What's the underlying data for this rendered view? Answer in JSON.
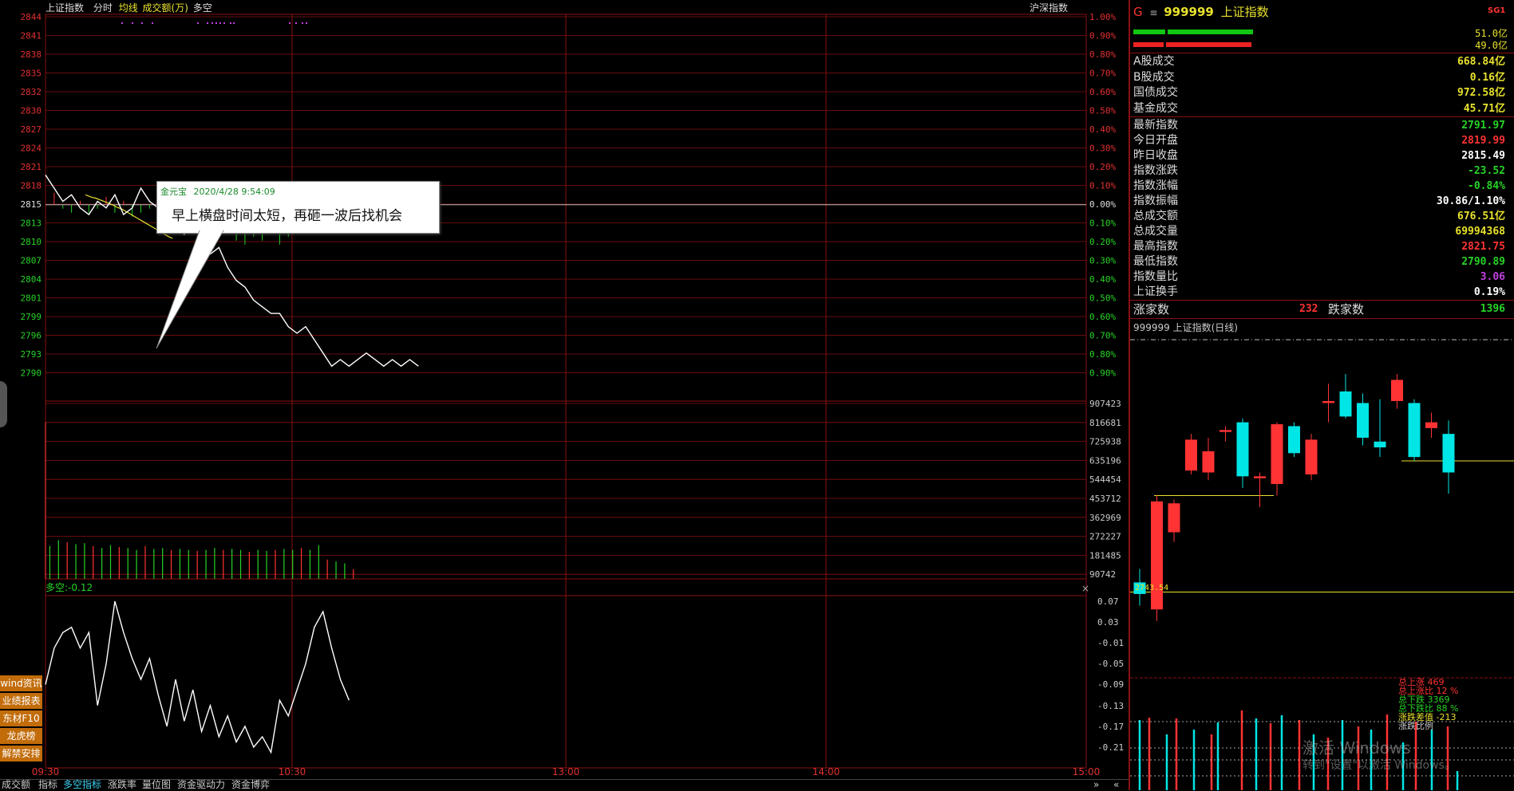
{
  "header": {
    "index_name": "上证指数",
    "mode": "分时",
    "ma_label": "均线",
    "vol_label": "成交额(万)",
    "dk_label": "多空",
    "market_tab": "沪深指数"
  },
  "price_axis": {
    "left_ticks": [
      "2844",
      "2841",
      "2838",
      "2835",
      "2832",
      "2830",
      "2827",
      "2824",
      "2821",
      "2818",
      "2815",
      "2813",
      "2810",
      "2807",
      "2804",
      "2801",
      "2799",
      "2796",
      "2793",
      "2790"
    ],
    "right_ticks": [
      "1.00%",
      "0.90%",
      "0.80%",
      "0.70%",
      "0.60%",
      "0.50%",
      "0.40%",
      "0.30%",
      "0.20%",
      "0.10%",
      "0.00%",
      "0.10%",
      "0.20%",
      "0.30%",
      "0.40%",
      "0.50%",
      "0.60%",
      "0.70%",
      "0.80%",
      "0.90%"
    ]
  },
  "volume_axis": {
    "ticks": [
      "907423",
      "816681",
      "725938",
      "635196",
      "544454",
      "453712",
      "362969",
      "272227",
      "181485",
      "90742"
    ]
  },
  "indicator": {
    "label": "多空:-0.12",
    "ticks": [
      "0.07",
      "0.03",
      "-0.01",
      "-0.05",
      "-0.09",
      "-0.13",
      "-0.17",
      "-0.21"
    ],
    "close_glyph": "×"
  },
  "time_axis": [
    "09:30",
    "10:30",
    "13:00",
    "14:00",
    "15:00"
  ],
  "annotation": {
    "author": "金元宝",
    "time": "2020/4/28 9:54:09",
    "text": "早上横盘时间太短，再砸一波后找机会"
  },
  "side_buttons": [
    "wind资讯",
    "业绩报表",
    "东材F10",
    "龙虎榜",
    "解禁安排"
  ],
  "bottom_tabs": [
    "成交额",
    "指标",
    "多空指标",
    "涨跌率",
    "量位图",
    "资金驱动力",
    "资金博弈"
  ],
  "bottom_right_glyphs": [
    "»",
    "«"
  ],
  "right_panel": {
    "header_prefix": "G",
    "header_glyph": "≡",
    "code": "999999",
    "name": "上证指数",
    "badge": "SG1",
    "bar_top_value": "51.0亿",
    "bar_bottom_value": "49.0亿",
    "turnover": [
      {
        "k": "A股成交",
        "v": "668.84亿"
      },
      {
        "k": "B股成交",
        "v": "0.16亿"
      },
      {
        "k": "国债成交",
        "v": "972.58亿"
      },
      {
        "k": "基金成交",
        "v": "45.71亿"
      }
    ],
    "stats": [
      {
        "k": "最新指数",
        "v": "2791.97",
        "c": "#27d327"
      },
      {
        "k": "今日开盘",
        "v": "2819.99",
        "c": "#ff3333"
      },
      {
        "k": "昨日收盘",
        "v": "2815.49",
        "c": "#ffffff"
      },
      {
        "k": "指数涨跌",
        "v": "-23.52",
        "c": "#27d327"
      },
      {
        "k": "指数涨幅",
        "v": "-0.84%",
        "c": "#27d327"
      },
      {
        "k": "指数振幅",
        "v": "30.86/1.10%",
        "c": "#ffffff"
      },
      {
        "k": "总成交额",
        "v": "676.51亿",
        "c": "#e8e22d"
      },
      {
        "k": "总成交量",
        "v": "69994368",
        "c": "#e8e22d"
      },
      {
        "k": "最高指数",
        "v": "2821.75",
        "c": "#ff3333"
      },
      {
        "k": "最低指数",
        "v": "2790.89",
        "c": "#27d327"
      },
      {
        "k": "指数量比",
        "v": "3.06",
        "c": "#c040e0"
      },
      {
        "k": "上证换手",
        "v": "0.19%",
        "c": "#ffffff"
      }
    ],
    "up_label": "涨家数",
    "up_value": "232",
    "down_label": "跌家数",
    "down_value": "1396",
    "kline_title": "999999 上证指数(日线)",
    "kline_low_label": "2743.54",
    "breadth": [
      {
        "t": "总上涨 469",
        "c": "#ff3333"
      },
      {
        "t": "总上涨比 12 %",
        "c": "#ff3333"
      },
      {
        "t": "总下跌 3369",
        "c": "#27d327"
      },
      {
        "t": "总下跌比 88 %",
        "c": "#27d327"
      },
      {
        "t": "涨跌差值 -213",
        "c": "#e8e22d"
      },
      {
        "t": "涨跌比例",
        "c": "#ccc"
      }
    ]
  },
  "watermark": {
    "line1": "激活 Windows",
    "line2": "转到\"设置\"以激活 Windows。"
  },
  "chart_data": [
    {
      "type": "line",
      "title": "上证指数 分时",
      "x_range": [
        "09:30",
        "15:00"
      ],
      "ylim": [
        2790,
        2844
      ],
      "prev_close": 2815.49,
      "price_x_minutes": [
        0,
        2,
        4,
        6,
        8,
        10,
        12,
        14,
        16,
        18,
        20,
        22,
        24,
        26,
        28,
        30,
        32,
        34,
        36,
        38,
        40,
        42,
        44,
        46,
        48,
        50,
        52,
        54,
        56,
        58,
        60,
        62,
        64,
        66,
        68,
        70,
        72,
        74,
        76,
        78,
        80,
        82,
        84,
        86
      ],
      "price": [
        2820,
        2818,
        2816,
        2817,
        2815,
        2814,
        2816,
        2815,
        2817,
        2814,
        2815,
        2818,
        2816,
        2815,
        2812,
        2813,
        2811,
        2813,
        2810,
        2808,
        2809,
        2806,
        2804,
        2803,
        2801,
        2800,
        2799,
        2799,
        2797,
        2796,
        2797,
        2795,
        2793,
        2791,
        2792,
        2791,
        2792,
        2793,
        2792,
        2791,
        2792,
        2791,
        2792,
        2791
      ],
      "avg_line": [
        2817,
        2816.8,
        2816.6,
        2816.5,
        2816.3,
        2816.1,
        2815.9,
        2815.7,
        2815.5,
        2815.2,
        2815,
        2814.8,
        2814.5,
        2814.2,
        2813.9,
        2813.6,
        2813.3,
        2813,
        2812.7,
        2812.4,
        2812.1,
        2811.8,
        2811.5,
        2811.2,
        2810.9,
        2810.6,
        2810.4
      ],
      "oscillation_bars_x_minutes": [
        2,
        4,
        6,
        8,
        10,
        12,
        14,
        16,
        18,
        20,
        22,
        24,
        26,
        28,
        30,
        32,
        34,
        36,
        38,
        40,
        42,
        44,
        46,
        48,
        50,
        52,
        54,
        56,
        58,
        60,
        62,
        64,
        66,
        68,
        70
      ],
      "oscillation_bars_value": [
        3,
        -1,
        -2,
        1,
        -2,
        -1,
        2,
        -2,
        1,
        -3,
        -2,
        -1,
        2,
        -2,
        -4,
        -5,
        -6,
        -4,
        -7,
        -8,
        -6,
        -9,
        -10,
        -8,
        -9,
        -7,
        -10,
        -8,
        -6,
        -5,
        -6,
        -4,
        -5,
        -2,
        -1
      ]
    },
    {
      "type": "bar",
      "title": "成交额(万)",
      "ylim": [
        0,
        907423
      ],
      "x_minutes": [
        0,
        1,
        3,
        5,
        7,
        9,
        11,
        13,
        15,
        17,
        19,
        21,
        23,
        25,
        27,
        29,
        31,
        33,
        35,
        37,
        39,
        41,
        43,
        45,
        47,
        49,
        51,
        53,
        55,
        57,
        59,
        61,
        63,
        65,
        67,
        69,
        71
      ],
      "values": [
        810000,
        170000,
        200000,
        190000,
        180000,
        185000,
        170000,
        160000,
        175000,
        165000,
        160000,
        150000,
        170000,
        155000,
        160000,
        150000,
        155000,
        150000,
        145000,
        150000,
        160000,
        150000,
        155000,
        150000,
        140000,
        150000,
        145000,
        150000,
        155000,
        150000,
        160000,
        150000,
        175000,
        100000,
        90000,
        80000,
        50000
      ]
    },
    {
      "type": "line",
      "title": "多空",
      "ylim": [
        -0.23,
        0.09
      ],
      "x_minutes": [
        0,
        2,
        4,
        6,
        8,
        10,
        12,
        14,
        16,
        18,
        20,
        22,
        24,
        26,
        28,
        30,
        32,
        34,
        36,
        38,
        40,
        42,
        44,
        46,
        48,
        50,
        52,
        54,
        56,
        58,
        60,
        62,
        64,
        66,
        68,
        70
      ],
      "values": [
        -0.09,
        -0.02,
        0.01,
        0.02,
        -0.02,
        0.01,
        -0.13,
        -0.05,
        0.07,
        0.01,
        -0.04,
        -0.08,
        -0.04,
        -0.11,
        -0.17,
        -0.08,
        -0.16,
        -0.1,
        -0.18,
        -0.13,
        -0.19,
        -0.15,
        -0.2,
        -0.17,
        -0.21,
        -0.19,
        -0.22,
        -0.12,
        -0.15,
        -0.1,
        -0.05,
        0.02,
        0.05,
        -0.02,
        -0.08,
        -0.12
      ]
    },
    {
      "type": "candlestick",
      "title": "999999 上证指数(日线)",
      "ylim": [
        2725,
        2880
      ],
      "candles": [
        {
          "o": 2755,
          "h": 2762,
          "l": 2743,
          "c": 2749
        },
        {
          "o": 2741,
          "h": 2800,
          "l": 2735,
          "c": 2797
        },
        {
          "o": 2781,
          "h": 2798,
          "l": 2776,
          "c": 2796
        },
        {
          "o": 2813,
          "h": 2832,
          "l": 2811,
          "c": 2829
        },
        {
          "o": 2812,
          "h": 2830,
          "l": 2808,
          "c": 2823
        },
        {
          "o": 2833,
          "h": 2836,
          "l": 2828,
          "c": 2834
        },
        {
          "o": 2838,
          "h": 2840,
          "l": 2804,
          "c": 2810
        },
        {
          "o": 2809,
          "h": 2812,
          "l": 2794,
          "c": 2810
        },
        {
          "o": 2806,
          "h": 2838,
          "l": 2800,
          "c": 2837
        },
        {
          "o": 2836,
          "h": 2838,
          "l": 2820,
          "c": 2822
        },
        {
          "o": 2811,
          "h": 2832,
          "l": 2808,
          "c": 2829
        },
        {
          "o": 2848,
          "h": 2858,
          "l": 2838,
          "c": 2849
        },
        {
          "o": 2854,
          "h": 2863,
          "l": 2840,
          "c": 2841
        },
        {
          "o": 2848,
          "h": 2853,
          "l": 2826,
          "c": 2830
        },
        {
          "o": 2828,
          "h": 2850,
          "l": 2820,
          "c": 2825
        },
        {
          "o": 2849,
          "h": 2863,
          "l": 2845,
          "c": 2860
        },
        {
          "o": 2848,
          "h": 2850,
          "l": 2818,
          "c": 2820
        },
        {
          "o": 2835,
          "h": 2843,
          "l": 2830,
          "c": 2838
        },
        {
          "o": 2832,
          "h": 2839,
          "l": 2801,
          "c": 2812
        }
      ]
    }
  ]
}
